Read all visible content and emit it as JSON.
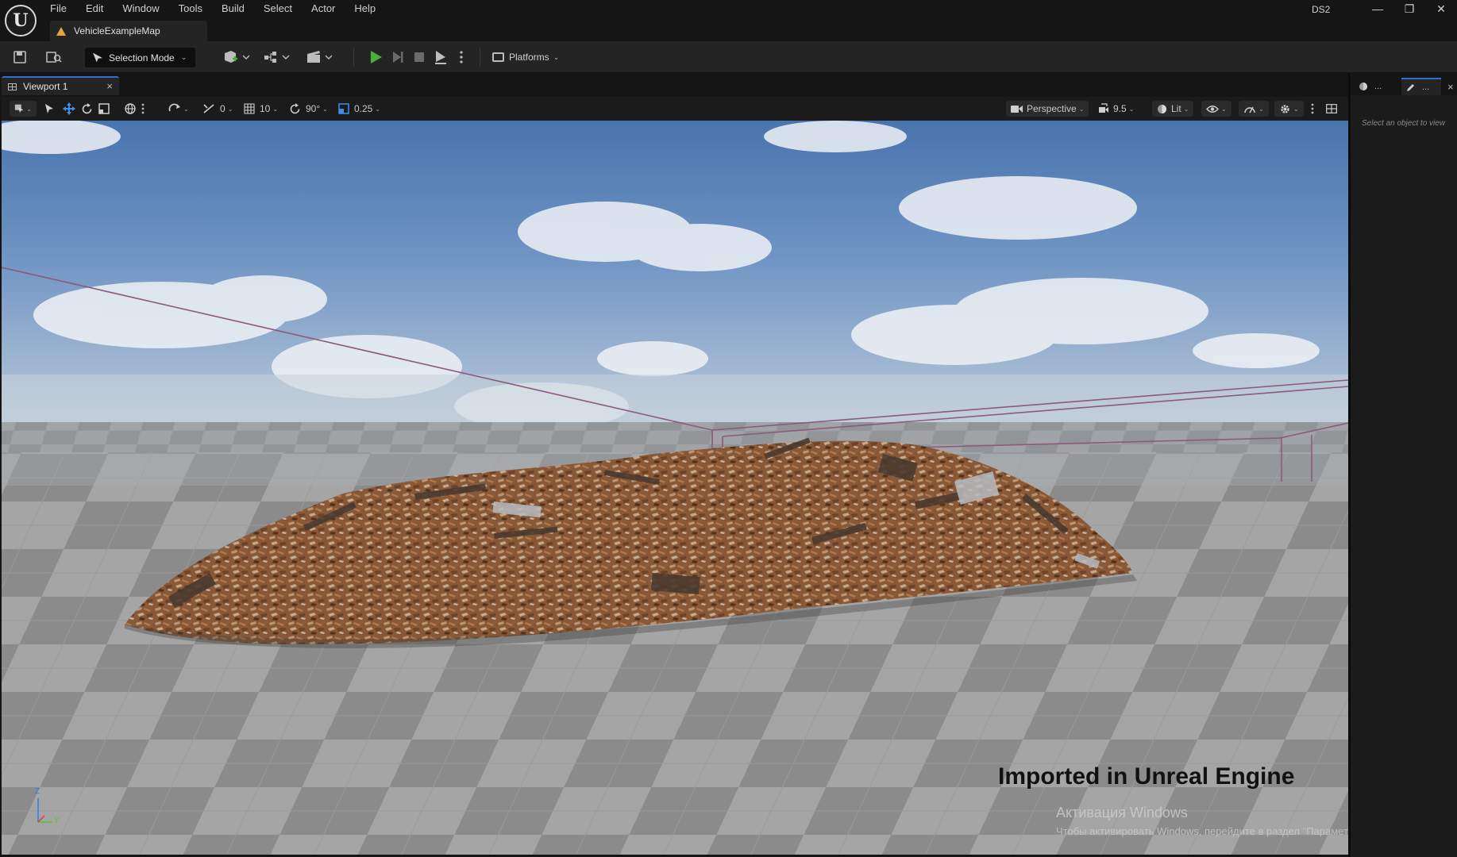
{
  "titlebar": {
    "logo_letter": "U",
    "menu": [
      "File",
      "Edit",
      "Window",
      "Tools",
      "Build",
      "Select",
      "Actor",
      "Help"
    ],
    "document_tab": "VehicleExampleMap",
    "project_name": "DS2",
    "window_controls": {
      "minimize": "—",
      "restore": "❐",
      "close": "✕"
    }
  },
  "toolbar": {
    "selection_mode": "Selection Mode",
    "platforms": "Platforms",
    "chevron": "⌄"
  },
  "viewport_tab": {
    "label": "Viewport 1",
    "close": "×"
  },
  "viewport_toolbar": {
    "translate_snap": "0",
    "grid_snap": "10",
    "rotation_snap": "90°",
    "scale_snap": "0.25",
    "view_mode": "Perspective",
    "camera_speed": "9.5",
    "lighting_mode": "Lit",
    "chevron": "⌄"
  },
  "viewport": {
    "overlay_caption": "Imported in Unreal Engine",
    "activation_title": "Активация Windows",
    "activation_subtitle": "Чтобы активировать Windows, перейдите в раздел \"Параметры\".",
    "axis_z": "Z",
    "axis_y": "Y"
  },
  "details_panel": {
    "tab1_label": "...",
    "tab2_label": "...",
    "close": "×",
    "empty_message": "Select an object to view"
  },
  "colors": {
    "accent_blue": "#2f6fd0",
    "play_green": "#4caf3a",
    "level_icon_orange": "#e8a33a",
    "panel_dark": "#1b1b1b",
    "toolbar_bg": "#242424"
  }
}
